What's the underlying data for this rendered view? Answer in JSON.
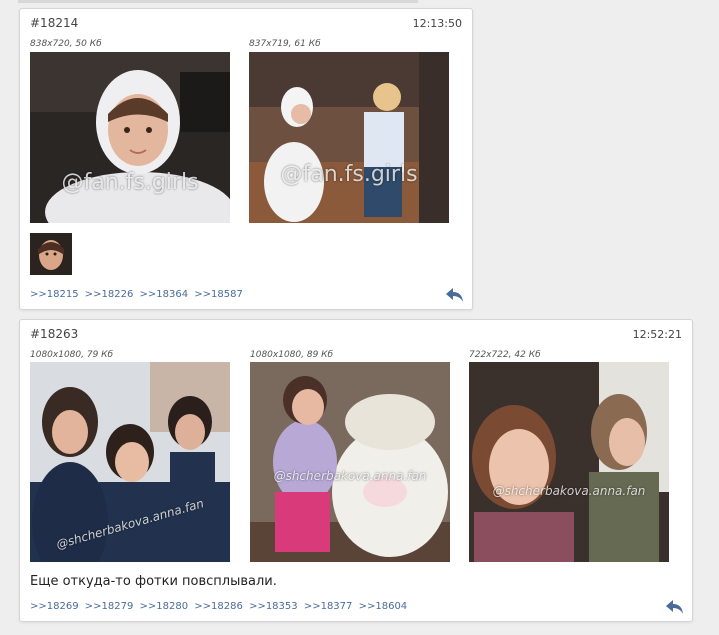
{
  "posts": [
    {
      "number": "#18214",
      "time": "12:13:50",
      "files": [
        {
          "info": "838x720, 50 Кб",
          "watermark": "@fan.fs.girls"
        },
        {
          "info": "837x719, 61 Кб",
          "watermark": "@fan.fs.girls"
        }
      ],
      "replies": [
        ">>18215",
        ">>18226",
        ">>18364",
        ">>18587"
      ],
      "reply_icon": "reply-arrow-icon"
    },
    {
      "number": "#18263",
      "time": "12:52:21",
      "files": [
        {
          "info": "1080x1080, 79 Кб",
          "watermark": "@shcherbakova.anna.fan"
        },
        {
          "info": "1080x1080, 89 Кб",
          "watermark": "@shcherbakova.anna.fan"
        },
        {
          "info": "722x722, 42 Кб",
          "watermark": "@shcherbakova.anna.fan"
        }
      ],
      "text": "Еще откуда-то фотки повсплывали.",
      "replies": [
        ">>18269",
        ">>18279",
        ">>18280",
        ">>18286",
        ">>18353",
        ">>18377",
        ">>18604"
      ],
      "reply_icon": "reply-arrow-icon"
    }
  ],
  "colors": {
    "link": "#4a6b9a",
    "background": "#eeeeee",
    "card": "#ffffff"
  }
}
